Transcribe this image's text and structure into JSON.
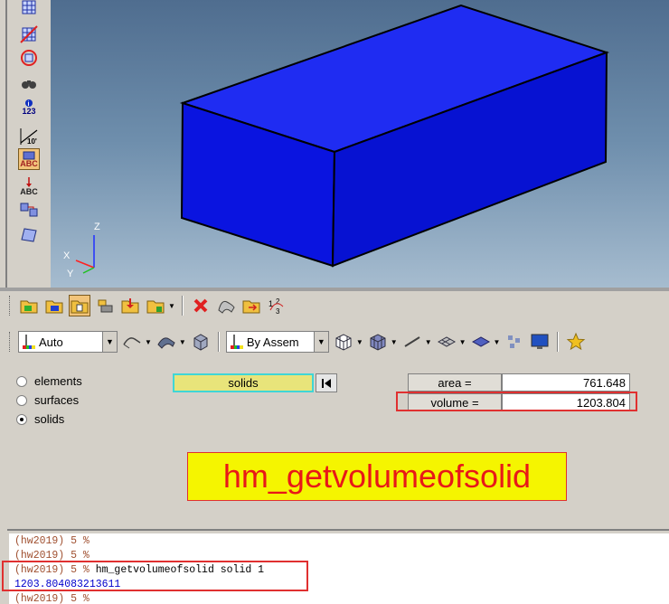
{
  "toolbar_left": {
    "icons": [
      "mesh-grid-icon",
      "mask-icon",
      "no-mask-icon",
      "find-binoculars-icon",
      "numbers-icon",
      "measure-icon",
      "label-abc-icon",
      "arrow-abc-icon",
      "transform-icon",
      "plane-icon"
    ],
    "numbers_label": "123",
    "measure_label": "10'",
    "abc_label": "ABC"
  },
  "viewport": {
    "triad": {
      "x_label": "X",
      "y_label": "Y",
      "z_label": "Z"
    },
    "solid_color": "#0a14e0"
  },
  "toolbar_row1": {
    "icons": [
      "model-collector-icon",
      "components-icon",
      "assembly-icon",
      "parts-icon",
      "export-icon",
      "import-icon",
      "delete-icon",
      "surfaces-icon",
      "organize-icon",
      "renumber-icon"
    ]
  },
  "toolbar_row2": {
    "color_mode": "Auto",
    "assem_mode": "By Assem",
    "icons": [
      "shaded-geom-icon",
      "shaded-elements-icon",
      "wireframe-icon",
      "mesh-mode-icon",
      "line-icon",
      "plane-view-icon",
      "surface-icon",
      "explode-icon",
      "monitor-icon",
      "star-icon"
    ]
  },
  "panel": {
    "radio_options": [
      {
        "label": "elements",
        "checked": false
      },
      {
        "label": "surfaces",
        "checked": false
      },
      {
        "label": "solids",
        "checked": true
      }
    ],
    "selector_label": "solids",
    "area_label": "area  =",
    "area_value": "761.648",
    "volume_label": "volume =",
    "volume_value": "1203.804",
    "banner_text": "hm_getvolumeofsolid"
  },
  "command_window": {
    "lines": [
      {
        "prompt": "(hw2019) 5 %",
        "text": ""
      },
      {
        "prompt": "(hw2019) 5 %",
        "text": ""
      },
      {
        "prompt": "(hw2019) 5 %",
        "text": " hm_getvolumeofsolid solid 1"
      },
      {
        "prompt": "",
        "text": "",
        "result": "1203.804083213611"
      },
      {
        "prompt": "(hw2019) 5 %",
        "text": ""
      }
    ]
  },
  "colors": {
    "highlight_red": "#e03030",
    "banner_yellow": "#f5f500",
    "selector_yellow": "#e8e47a",
    "selector_border": "#3fd6d6"
  }
}
